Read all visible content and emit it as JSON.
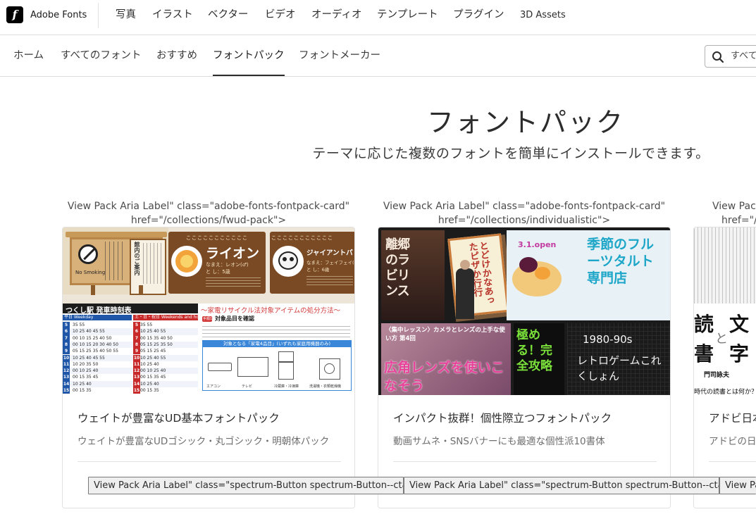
{
  "brand": {
    "name": "Adobe Fonts",
    "logo_letter": "f"
  },
  "topnav": {
    "items": [
      "写真",
      "イラスト",
      "ベクター",
      "ビデオ",
      "オーディオ",
      "テンプレート",
      "プラグイン",
      "3D Assets"
    ]
  },
  "subnav": {
    "items": [
      "ホーム",
      "すべてのフォント",
      "おすすめ",
      "フォントパック",
      "フォントメーカー"
    ],
    "active": "フォントパック",
    "search_placeholder": "すべて"
  },
  "hero": {
    "title": "フォントパック",
    "subtitle": "テーマに応じた複数のフォントを簡単にインストールできます。"
  },
  "cards": [
    {
      "label_line1": "View Pack Aria Label\" class=\"adobe-fonts-fontpack-card\"",
      "label_line2": "href=\"/collections/fwud-pack\">",
      "title": "ウェイトが豊富なUD基本フォントパック",
      "description": "ウェイトが豊富なUDゴシック・丸ゴシック・明朝体パック",
      "cta_label": "View Pack Aria Label\" class=\"spectrum-Button spectrum-Button--cta add-o",
      "thumb": {
        "no_smoking": "No Smoking",
        "guide": "館内のご案内",
        "lion_banner": "こここここここここここ",
        "lion_title": "ライオン",
        "lion_sub": "なまえ：レオン(♂)",
        "lion_age": "と し：5歳",
        "panda_title": "ジャイアントパ",
        "panda_sub": "なまえ：フェイフェイ(♀)",
        "panda_age": "と し：6歳",
        "timetable_title": "つくし駅 発車時刻表",
        "weekday": "平日 Weekday",
        "holiday": "土・日・祝日 Weekends and holidays",
        "recycle_title": "～家電リサイクル法対象アイテムの処分方法～",
        "step_label": "手順1",
        "step_text": "対象品目を確認",
        "blue_banner": "対象となる「家電4品目」(いずれも家庭用機器のみ)",
        "appliances": [
          "エアコン",
          "テレビ",
          "冷蔵庫・冷凍庫",
          "洗濯機・衣類乾燥機"
        ],
        "timetable_hours": [
          "5",
          "6",
          "7",
          "8",
          "9",
          "10",
          "11",
          "12",
          "13",
          "14",
          "15"
        ],
        "timetable_weekday": [
          "35 55",
          "10 25 40 45 55",
          "00 10 15 25 40 50",
          "00 10 15 20 30 40 50",
          "05 15 25 35 40 50 55",
          "10 25 40 45 55",
          "10 20 35 50",
          "00 10 25 40",
          "00 15 35 45",
          "10 25 40",
          "00 15 35"
        ],
        "timetable_holiday": [
          "35 55",
          "10 25 40 55",
          "00 15 35 40 50",
          "05 15 25 35 50",
          "05 15 25 45",
          "10 25 40 55",
          "10 25 40",
          "00 10 25 40",
          "00 15 35 45",
          "10 25 40",
          "00 15 35"
        ]
      }
    },
    {
      "label_line1": "View Pack Aria Label\" class=\"adobe-fonts-fontpack-card\"",
      "label_line2": "href=\"/collections/individualistic\">",
      "title": "インパクト抜群！個性際立つフォントパック",
      "description": "動画サムネ・SNSバナーにも最適な個性派10書体",
      "cta_label": "View Pack Aria Label\" class=\"spectrum-Button spectrum-Button--cta add-o",
      "thumb": {
        "labyrinth": "離郷のラビリンス",
        "fortune": "とどけかなあったピザか行行",
        "date": "3.1.open",
        "fruit_title": "季節のフルーツタルト専門店",
        "lens_tag": "〈集中レッスン〉カメラとレンズの上手な使い方 第4回",
        "lens_title": "広角レンズを使いこなそう",
        "complete": "極める！完全攻略",
        "retro_year": "1980-90s",
        "retro_title": "レトロゲームこれくしょん"
      }
    },
    {
      "label_line1": "View Pack",
      "label_line2": "href=\"/c",
      "title": "アドビ日本",
      "description": "アドビの日",
      "cta_label": "View Pa",
      "thumb": {
        "read": "読",
        "write": "書",
        "and": "と",
        "bun": "文",
        "ji": "字",
        "author": "門司詠夫",
        "footer": "時代の読書とは何か？"
      }
    }
  ]
}
